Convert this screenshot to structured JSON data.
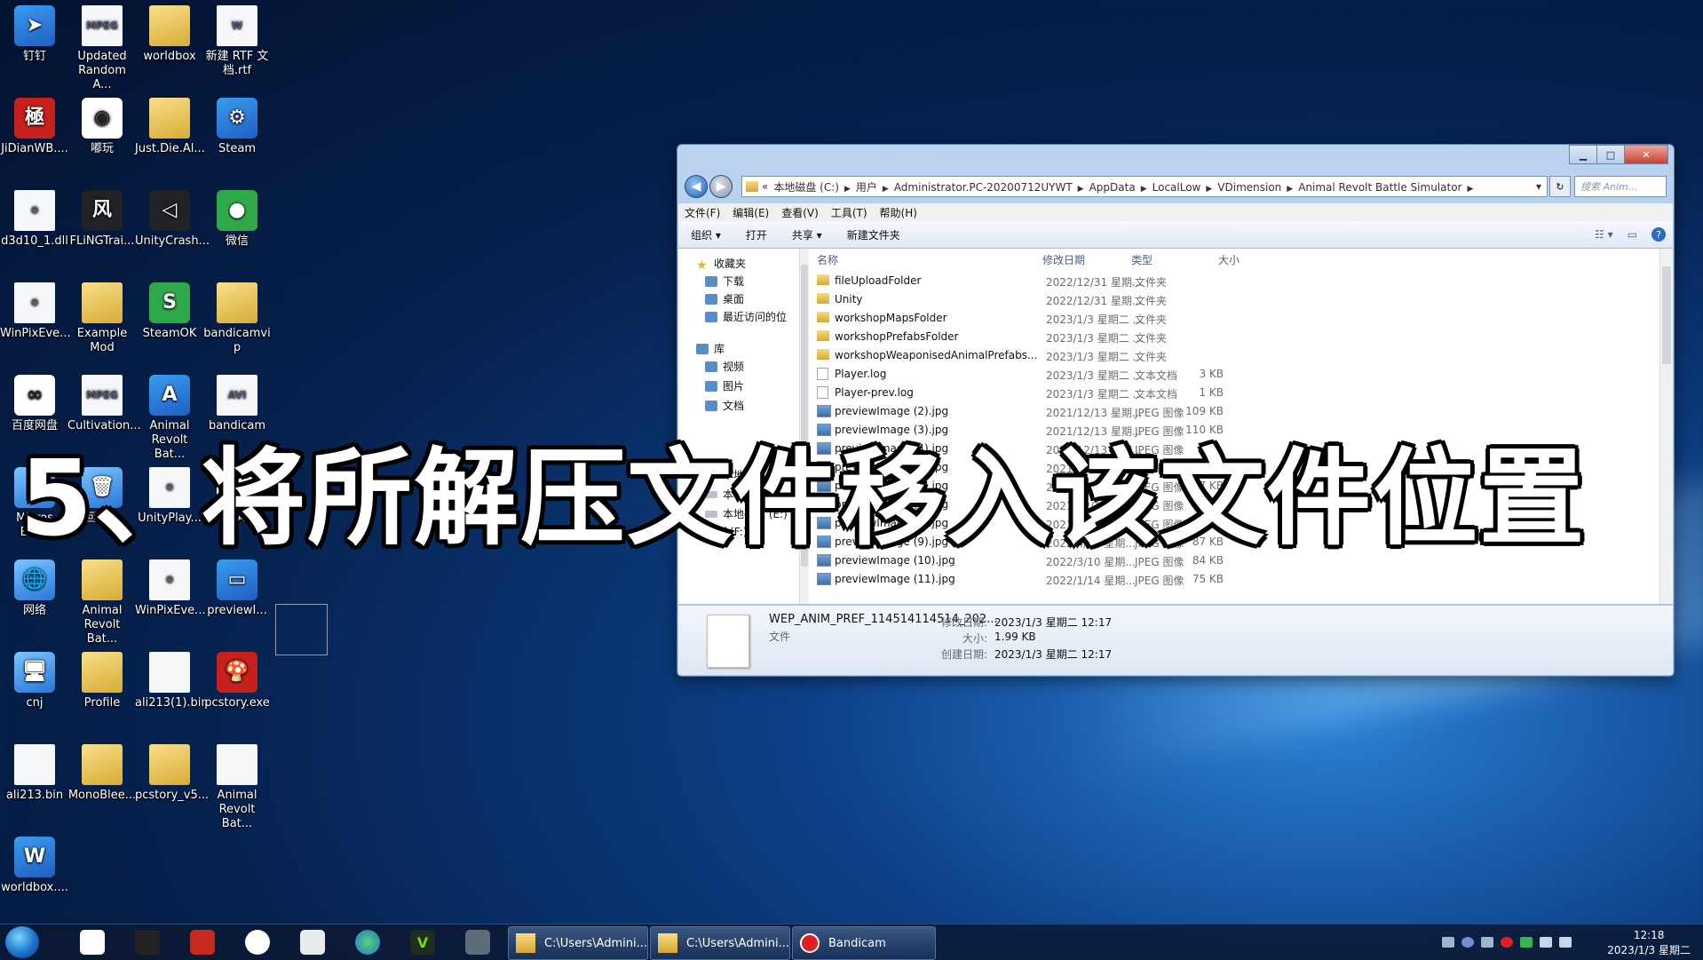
{
  "desktop": {
    "icons": [
      {
        "label": "钉钉",
        "glyph": "➤"
      },
      {
        "label": "Updated Random A...",
        "glyph": "MPEG"
      },
      {
        "label": "worldbox",
        "glyph": ""
      },
      {
        "label": "新建 RTF 文档.rtf",
        "glyph": "W"
      },
      {
        "label": "JiDianWB....",
        "glyph": "極"
      },
      {
        "label": "嘟玩",
        "glyph": "◉"
      },
      {
        "label": "Just.Die.Al...",
        "glyph": ""
      },
      {
        "label": "Steam",
        "glyph": "⚙"
      },
      {
        "label": "d3d10_1.dll",
        "glyph": "⚙"
      },
      {
        "label": "FLiNGTrai...",
        "glyph": "风"
      },
      {
        "label": "UnityCrash...",
        "glyph": "◁"
      },
      {
        "label": "微信",
        "glyph": "●"
      },
      {
        "label": "WinPixEve...",
        "glyph": "⚙"
      },
      {
        "label": "Example Mod",
        "glyph": ""
      },
      {
        "label": "SteamOK",
        "glyph": "S"
      },
      {
        "label": "bandicamvi p",
        "glyph": ""
      },
      {
        "label": "百度网盘",
        "glyph": "∞"
      },
      {
        "label": "Cultivation...",
        "glyph": "MPEG"
      },
      {
        "label": "Animal Revolt Bat...",
        "glyph": "A"
      },
      {
        "label": "bandicam",
        "glyph": "AVI"
      },
      {
        "label": "Micros Edge",
        "glyph": "e"
      },
      {
        "label": "回收站",
        "glyph": "🗑"
      },
      {
        "label": "UnityPlay...",
        "glyph": "⚙"
      },
      {
        "label": "WEP_ANI...",
        "glyph": ""
      },
      {
        "label": "网络",
        "glyph": "🌐"
      },
      {
        "label": "Animal Revolt Bat...",
        "glyph": ""
      },
      {
        "label": "WinPixEve...",
        "glyph": "⚙"
      },
      {
        "label": "previewI...",
        "glyph": "▭"
      },
      {
        "label": "cnj",
        "glyph": "🖥"
      },
      {
        "label": "Profile",
        "glyph": ""
      },
      {
        "label": "ali213(1).bin",
        "glyph": ""
      },
      {
        "label": "pcstory.exe",
        "glyph": "🍄"
      },
      {
        "label": "ali213.bin",
        "glyph": ""
      },
      {
        "label": "MonoBlee...",
        "glyph": ""
      },
      {
        "label": "pcstory_v5...",
        "glyph": ""
      },
      {
        "label": "Animal Revolt Bat...",
        "glyph": ""
      },
      {
        "label": "worldbox....",
        "glyph": "W"
      }
    ]
  },
  "explorer": {
    "title_buttons": {
      "minimize": "▁",
      "maximize": "□",
      "close": "✕"
    },
    "back": "◀",
    "forward": "▶",
    "address": {
      "prefix": "«",
      "crumbs": [
        "本地磁盘 (C:)",
        "用户",
        "Administrator.PC-20200712UYWT",
        "AppData",
        "LocalLow",
        "VDimension",
        "Animal Revolt Battle Simulator"
      ],
      "sep": "▶",
      "dropdown": "▾",
      "refresh": "↻"
    },
    "search_placeholder": "搜索 Anim...",
    "menu": [
      "文件(F)",
      "编辑(E)",
      "查看(V)",
      "工具(T)",
      "帮助(H)"
    ],
    "toolbar": {
      "organize": "组织 ▾",
      "open": "打开",
      "share": "共享 ▾",
      "new_folder": "新建文件夹"
    },
    "nav": {
      "favorites": "收藏夹",
      "downloads": "下载",
      "desktop": "桌面",
      "recent": "最近访问的位",
      "libraries": "库",
      "videos": "视频",
      "pictures": "图片",
      "documents": "文档",
      "local_c": "本地磁盘 (C",
      "local_d": "本地磁盘 (D",
      "local_e": "本地磁盘 (E:)",
      "drive_f": "f (F:)"
    },
    "columns": {
      "name": "名称",
      "date": "修改日期",
      "type": "类型",
      "size": "大小"
    },
    "files": [
      {
        "name": "fileUploadFolder",
        "date": "2022/12/31 星期...",
        "type": "文件夹",
        "size": "",
        "kind": "folder"
      },
      {
        "name": "Unity",
        "date": "2022/12/31 星期...",
        "type": "文件夹",
        "size": "",
        "kind": "folder"
      },
      {
        "name": "workshopMapsFolder",
        "date": "2023/1/3 星期二 ...",
        "type": "文件夹",
        "size": "",
        "kind": "folder"
      },
      {
        "name": "workshopPrefabsFolder",
        "date": "2023/1/3 星期二 ...",
        "type": "文件夹",
        "size": "",
        "kind": "folder"
      },
      {
        "name": "workshopWeaponisedAnimalPrefabs...",
        "date": "2023/1/3 星期二 ...",
        "type": "文件夹",
        "size": "",
        "kind": "folder"
      },
      {
        "name": "Player.log",
        "date": "2023/1/3 星期二 ...",
        "type": "文本文档",
        "size": "3 KB",
        "kind": "text"
      },
      {
        "name": "Player-prev.log",
        "date": "2023/1/3 星期二 ...",
        "type": "文本文档",
        "size": "1 KB",
        "kind": "text"
      },
      {
        "name": "previewImage (2).jpg",
        "date": "2021/12/13 星期...",
        "type": "JPEG 图像",
        "size": "109 KB",
        "kind": "img"
      },
      {
        "name": "previewImage (3).jpg",
        "date": "2021/12/13 星期...",
        "type": "JPEG 图像",
        "size": "110 KB",
        "kind": "img"
      },
      {
        "name": "previewImage (4).jpg",
        "date": "2021/12/13 星期...",
        "type": "JPEG 图像",
        "size": "",
        "kind": "img"
      },
      {
        "name": "previewImage (5).jpg",
        "date": "2021/11/2 星期...",
        "type": "JPEG 图像",
        "size": "KB",
        "kind": "img"
      },
      {
        "name": "previewImage (6).jpg",
        "date": "2021/10/25 星期...",
        "type": "JPEG 图像",
        "size": "37 KB",
        "kind": "img"
      },
      {
        "name": "previewImage (7).jpg",
        "date": "2021/12/10 星期...",
        "type": "JPEG 图像",
        "size": "",
        "kind": "img"
      },
      {
        "name": "previewImage (8).jpg",
        "date": "2021/11/21 星期...",
        "type": "JPEG 图像",
        "size": "53 KB",
        "kind": "img"
      },
      {
        "name": "previewImage (9).jpg",
        "date": "2022/4/20 星期...",
        "type": "JPEG 图像",
        "size": "87 KB",
        "kind": "img"
      },
      {
        "name": "previewImage (10).jpg",
        "date": "2022/3/10 星期...",
        "type": "JPEG 图像",
        "size": "84 KB",
        "kind": "img"
      },
      {
        "name": "previewImage (11).jpg",
        "date": "2022/1/14 星期...",
        "type": "JPEG 图像",
        "size": "75 KB",
        "kind": "img"
      }
    ],
    "details": {
      "name": "WEP_ANIM_PREF_114514114514_202...",
      "kind": "文件",
      "modified_label": "修改日期:",
      "modified": "2023/1/3 星期二 12:17",
      "size_label": "大小:",
      "size": "1.99 KB",
      "created_label": "创建日期:",
      "created": "2023/1/3 星期二 12:17"
    }
  },
  "caption": "5、将所解压文件移入该文件位置",
  "taskbar": {
    "tasks": [
      "C:\\Users\\Admini...",
      "C:\\Users\\Admini...",
      "Bandicam"
    ],
    "time": "12:18",
    "date": "2023/1/3 星期二"
  }
}
